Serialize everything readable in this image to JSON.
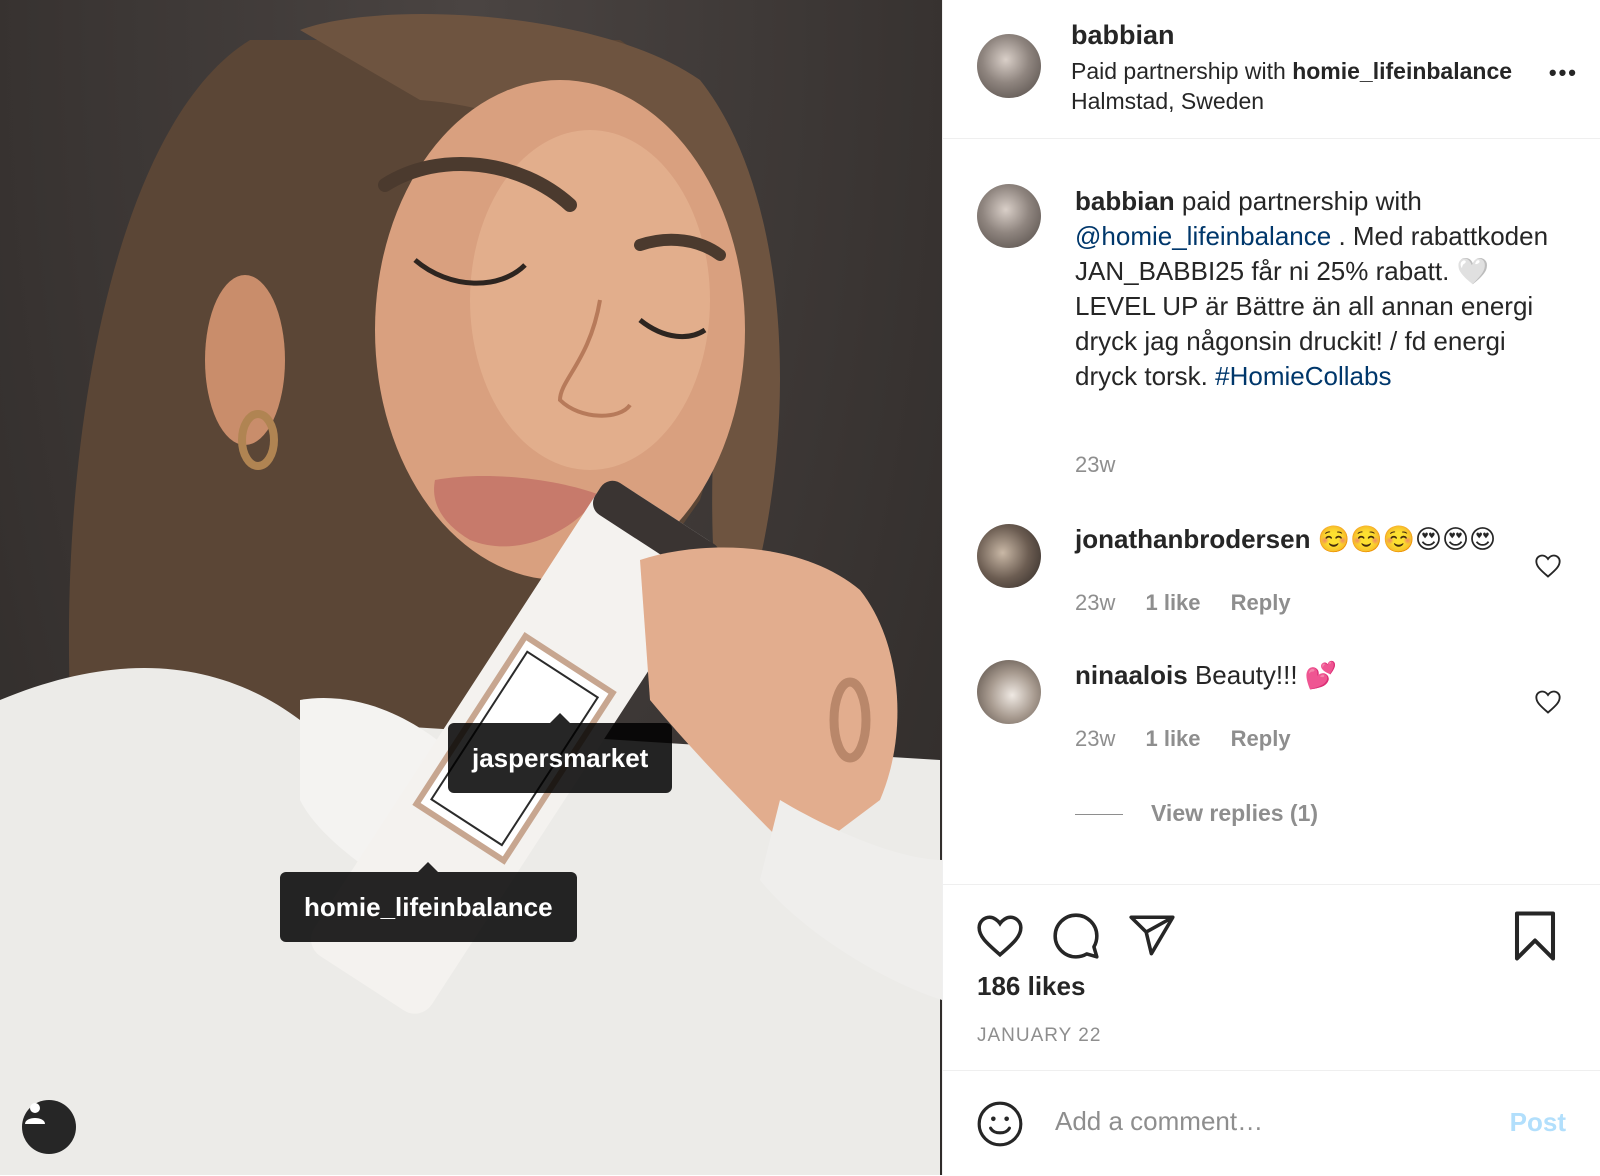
{
  "post": {
    "author": "babbian",
    "partnership_prefix": "Paid partnership with",
    "partner": "homie_lifeinbalance",
    "location": "Halmstad, Sweden",
    "more": "•••",
    "photo_tags": [
      "jaspersmarket",
      "homie_lifeinbalance"
    ]
  },
  "caption": {
    "author": "babbian",
    "lead": "paid partnership with",
    "mention": "@homie_lifeinbalance",
    "body1": ". Med rabattkoden JAN_BABBI25 får ni 25% rabatt. 🤍 LEVEL UP är Bättre än all annan energi dryck jag någonsin druckit! / fd energi dryck torsk.",
    "hashtag": "#HomieCollabs",
    "time": "23w"
  },
  "comments": [
    {
      "user": "jonathanbrodersen",
      "text": "☺️☺️☺️😍😍😍",
      "time": "23w",
      "likes": "1 like",
      "reply": "Reply"
    },
    {
      "user": "ninaalois",
      "text": "Beauty!!! 💕",
      "time": "23w",
      "likes": "1 like",
      "reply": "Reply"
    }
  ],
  "view_replies": "View replies (1)",
  "likes": "186 likes",
  "date": "JANUARY 22",
  "comment_box": {
    "placeholder": "Add a comment…",
    "post_label": "Post"
  },
  "colors": {
    "link": "#00376b",
    "muted": "#8e8e8e",
    "post_disabled": "#b2dffc"
  },
  "icons": [
    "heart-icon",
    "comment-icon",
    "share-icon",
    "bookmark-icon",
    "emoji-icon",
    "user-tag-icon"
  ]
}
